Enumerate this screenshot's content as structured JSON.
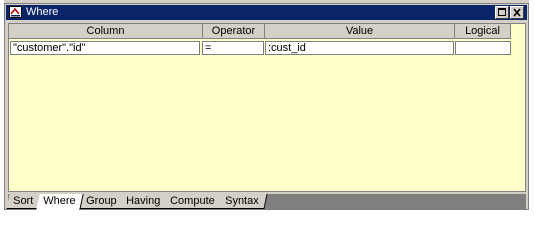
{
  "window": {
    "title": "Where",
    "accent": "#0a246a",
    "icon": "where-clause-icon"
  },
  "grid": {
    "columns": [
      {
        "label": "Column"
      },
      {
        "label": "Operator"
      },
      {
        "label": "Value"
      },
      {
        "label": "Logical"
      }
    ],
    "rows": [
      {
        "column": "\"customer\".\"id\"",
        "operator": "=",
        "value": ":cust_id",
        "logical": ""
      }
    ],
    "background": "#ffffcc"
  },
  "tabs": [
    {
      "label": "Sort",
      "active": false
    },
    {
      "label": "Where",
      "active": true
    },
    {
      "label": "Group",
      "active": false
    },
    {
      "label": "Having",
      "active": false
    },
    {
      "label": "Compute",
      "active": false
    },
    {
      "label": "Syntax",
      "active": false
    }
  ]
}
